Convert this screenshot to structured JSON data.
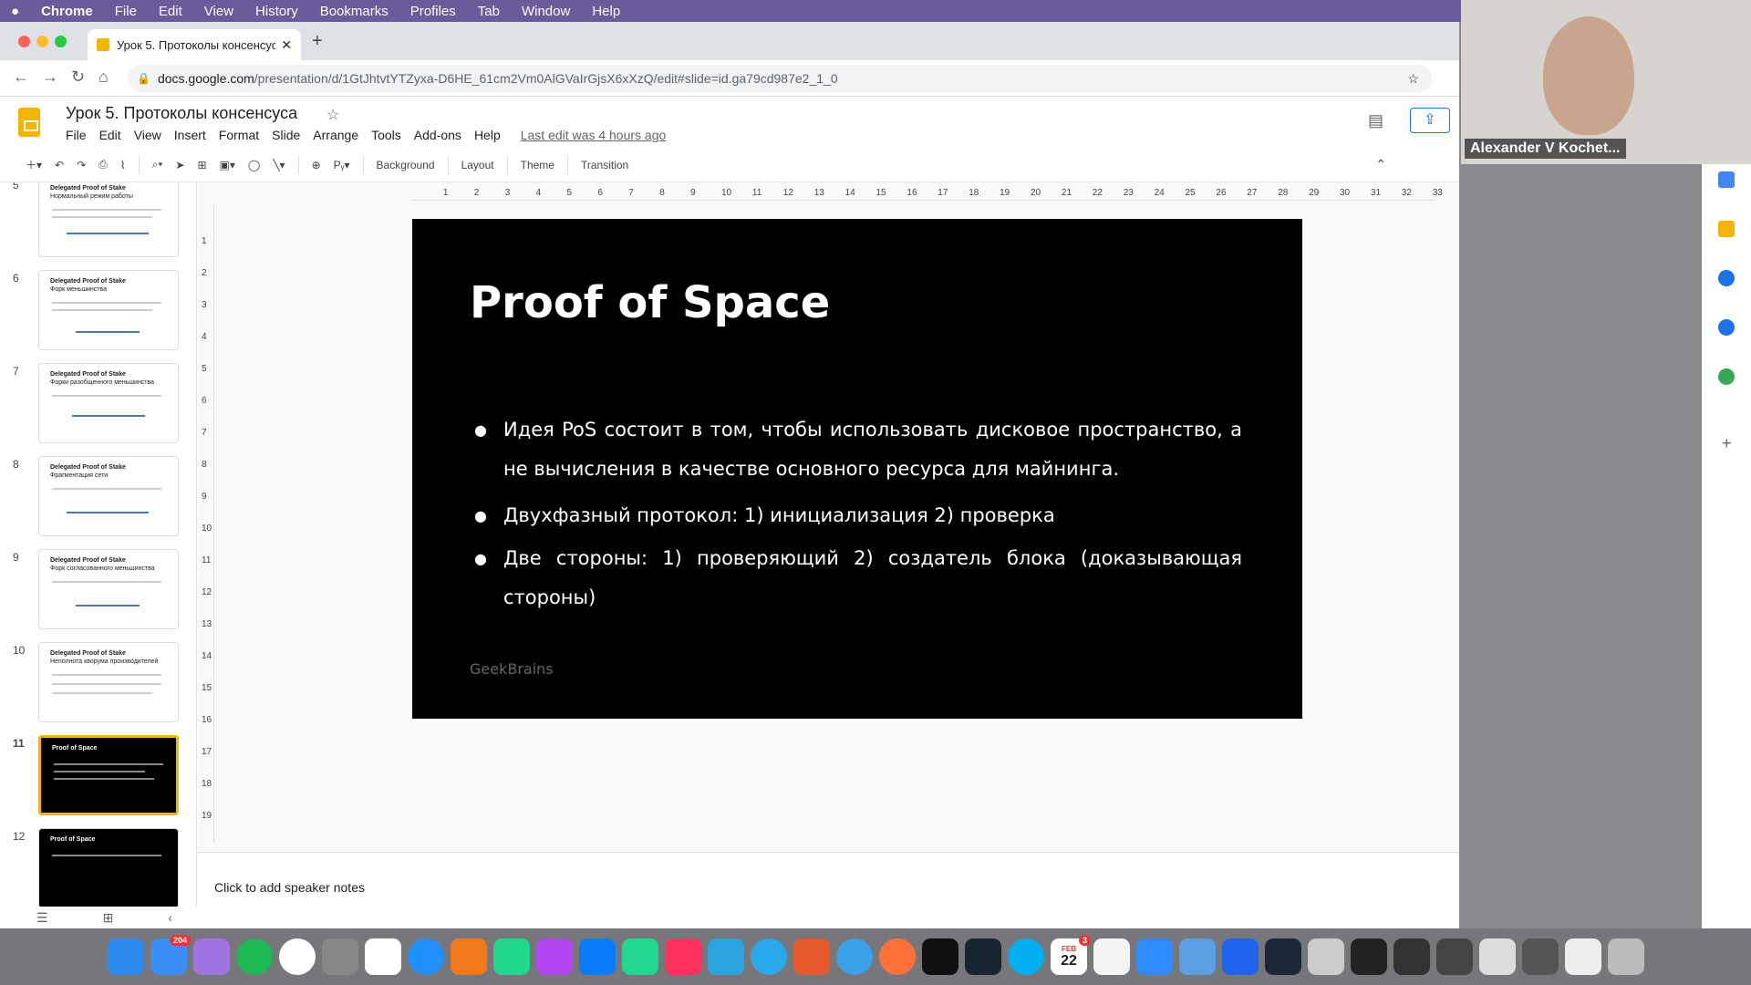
{
  "macbar": {
    "apple": "",
    "app": "Chrome",
    "items": [
      "File",
      "Edit",
      "View",
      "History",
      "Bookmarks",
      "Profiles",
      "Tab",
      "Window",
      "Help"
    ]
  },
  "browser": {
    "tab_title": "Урок 5. Протоколы консенсус",
    "url_host": "docs.google.com",
    "url_path": "/presentation/d/1GtJhtvtYTZyxa-D6HE_61cm2Vm0AlGVaIrGjsX6xXzQ/edit#slide=id.ga79cd987e2_1_0"
  },
  "doc": {
    "title": "Урок 5. Протоколы консенсуса",
    "menus": [
      "File",
      "Edit",
      "View",
      "Insert",
      "Format",
      "Slide",
      "Arrange",
      "Tools",
      "Add-ons",
      "Help"
    ],
    "last_edit": "Last edit was 4 hours ago"
  },
  "toolbar": {
    "background": "Background",
    "layout": "Layout",
    "theme": "Theme",
    "transition": "Transition"
  },
  "filmstrip": [
    {
      "num": "5",
      "t1": "Delegated Proof of Stake",
      "t2": "Нормальный режим работы"
    },
    {
      "num": "6",
      "t1": "Delegated Proof of Stake",
      "t2": "Форк меньшинства"
    },
    {
      "num": "7",
      "t1": "Delegated Proof of Stake",
      "t2": "Форки разобщенного меньшинства"
    },
    {
      "num": "8",
      "t1": "Delegated Proof of Stake",
      "t2": "Фрагментация сети"
    },
    {
      "num": "9",
      "t1": "Delegated Proof of Stake",
      "t2": "Форк согласованного меньшинства"
    },
    {
      "num": "10",
      "t1": "Delegated Proof of Stake",
      "t2": "Неполнота кворума производителей"
    },
    {
      "num": "11",
      "t1": "Proof of Space",
      "t2": ""
    },
    {
      "num": "12",
      "t1": "Proof of Space",
      "t2": ""
    }
  ],
  "slide": {
    "title": "Proof of Space",
    "bullets": [
      "Идея PoS состоит в том, чтобы использовать дисковое пространство, а не вычисления в качестве основного ресурса для майнинга.",
      "Двухфазный протокол: 1) инициализация 2) проверка",
      "Две стороны: 1) проверяющий 2) создатель блока (доказывающая стороны)"
    ],
    "logo": "GeekBrains"
  },
  "notes": "Click to add speaker notes",
  "video": {
    "name": "Alexander V Kochet..."
  },
  "dock": {
    "mail_badge": "204",
    "calendar_day": "22",
    "calendar_month": "FEB",
    "calendar_badge": "3"
  }
}
